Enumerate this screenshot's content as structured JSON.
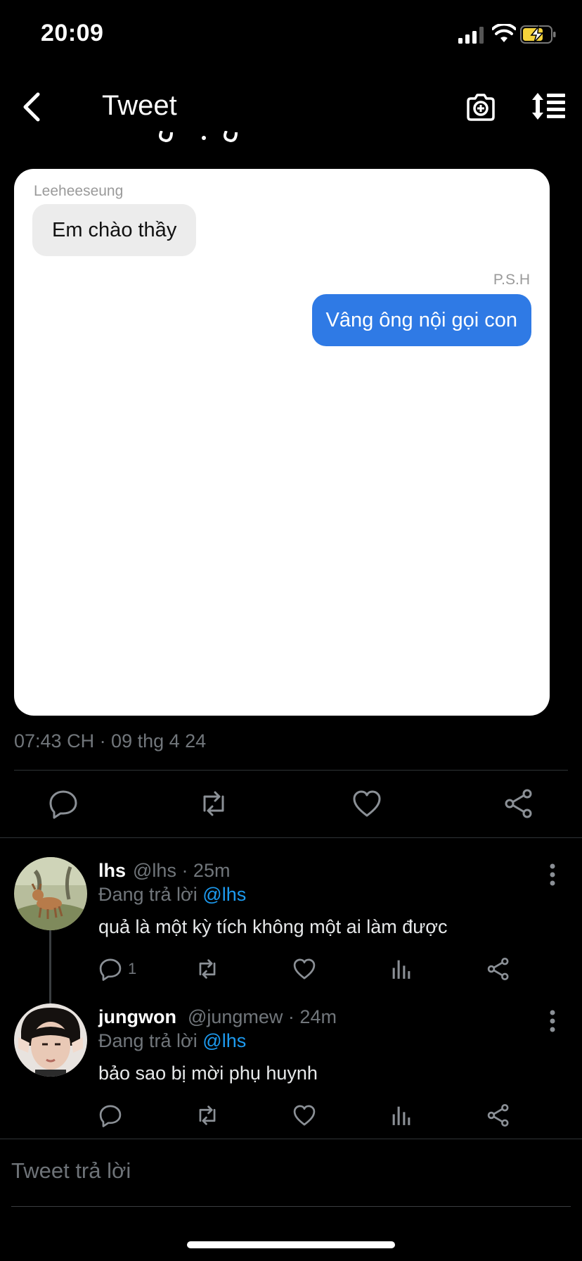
{
  "status_bar": {
    "time": "20:09"
  },
  "nav": {
    "title": "Tweet"
  },
  "chat_card": {
    "sender_name": "Leeheeseung",
    "sender_message": "Em chào thầy",
    "receiver_name": "P.S.H",
    "receiver_message": "Vâng ông nội gọi con"
  },
  "tweet": {
    "timestamp": "07:43 CH · 09 thg 4 24"
  },
  "replies": [
    {
      "name": "lhs",
      "meta": "@lhs · 25m",
      "replying_prefix": "Đang trả lời",
      "replying_to": "@lhs",
      "text": "quả là một kỳ tích không một ai làm được",
      "reply_count": "1"
    },
    {
      "name": "jungwon",
      "meta": "@jungmew · 24m",
      "replying_prefix": "Đang trả lời",
      "replying_to": "@lhs",
      "text": "bảo sao bị mời phụ huynh",
      "reply_count": ""
    }
  ],
  "reply_box": {
    "placeholder": "Tweet trả lời"
  },
  "colors": {
    "accent": "#1d9bf0",
    "bubble_blue": "#2f7ae5",
    "muted": "#71767b"
  }
}
